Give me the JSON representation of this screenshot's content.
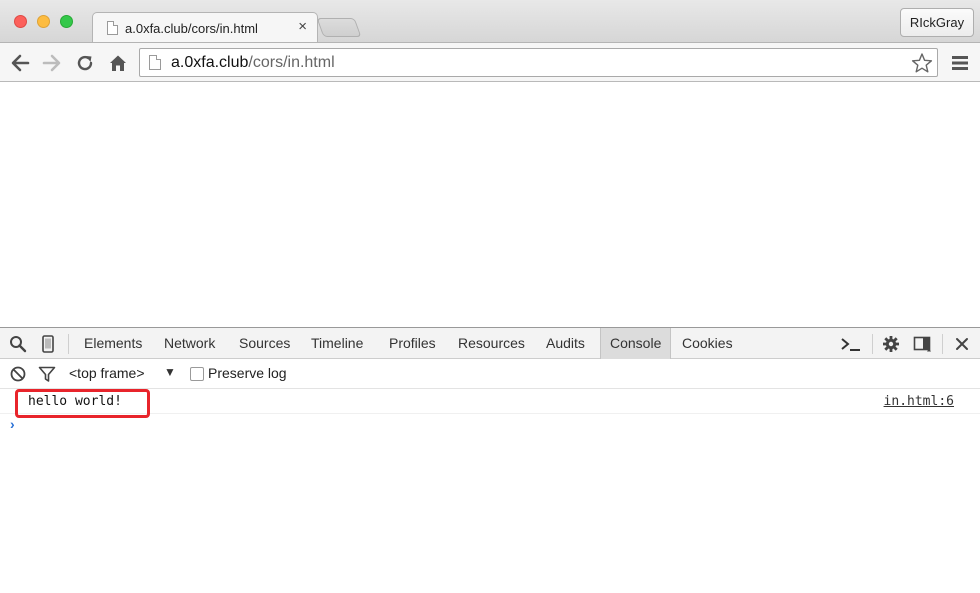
{
  "window": {
    "profile_name": "RIckGray"
  },
  "tabs": [
    {
      "title": "a.0xfa.club/cors/in.html",
      "close": "×"
    }
  ],
  "toolbar": {
    "url_host": "a.0xfa.club",
    "url_path": "/cors/in.html"
  },
  "devtools": {
    "tabs": [
      "Elements",
      "Network",
      "Sources",
      "Timeline",
      "Profiles",
      "Resources",
      "Audits",
      "Console",
      "Cookies"
    ],
    "selected_tab": "Console",
    "context_label": "<top frame>",
    "context_arrow": "▼",
    "preserve_log_label": "Preserve log",
    "preserve_log_checked": false,
    "console": {
      "messages": [
        {
          "text": "hello world!",
          "source": "in.html:6"
        }
      ],
      "prompt_symbol": "›"
    }
  },
  "colors": {
    "highlight": "#e8242b",
    "prompt": "#2a71d6"
  }
}
